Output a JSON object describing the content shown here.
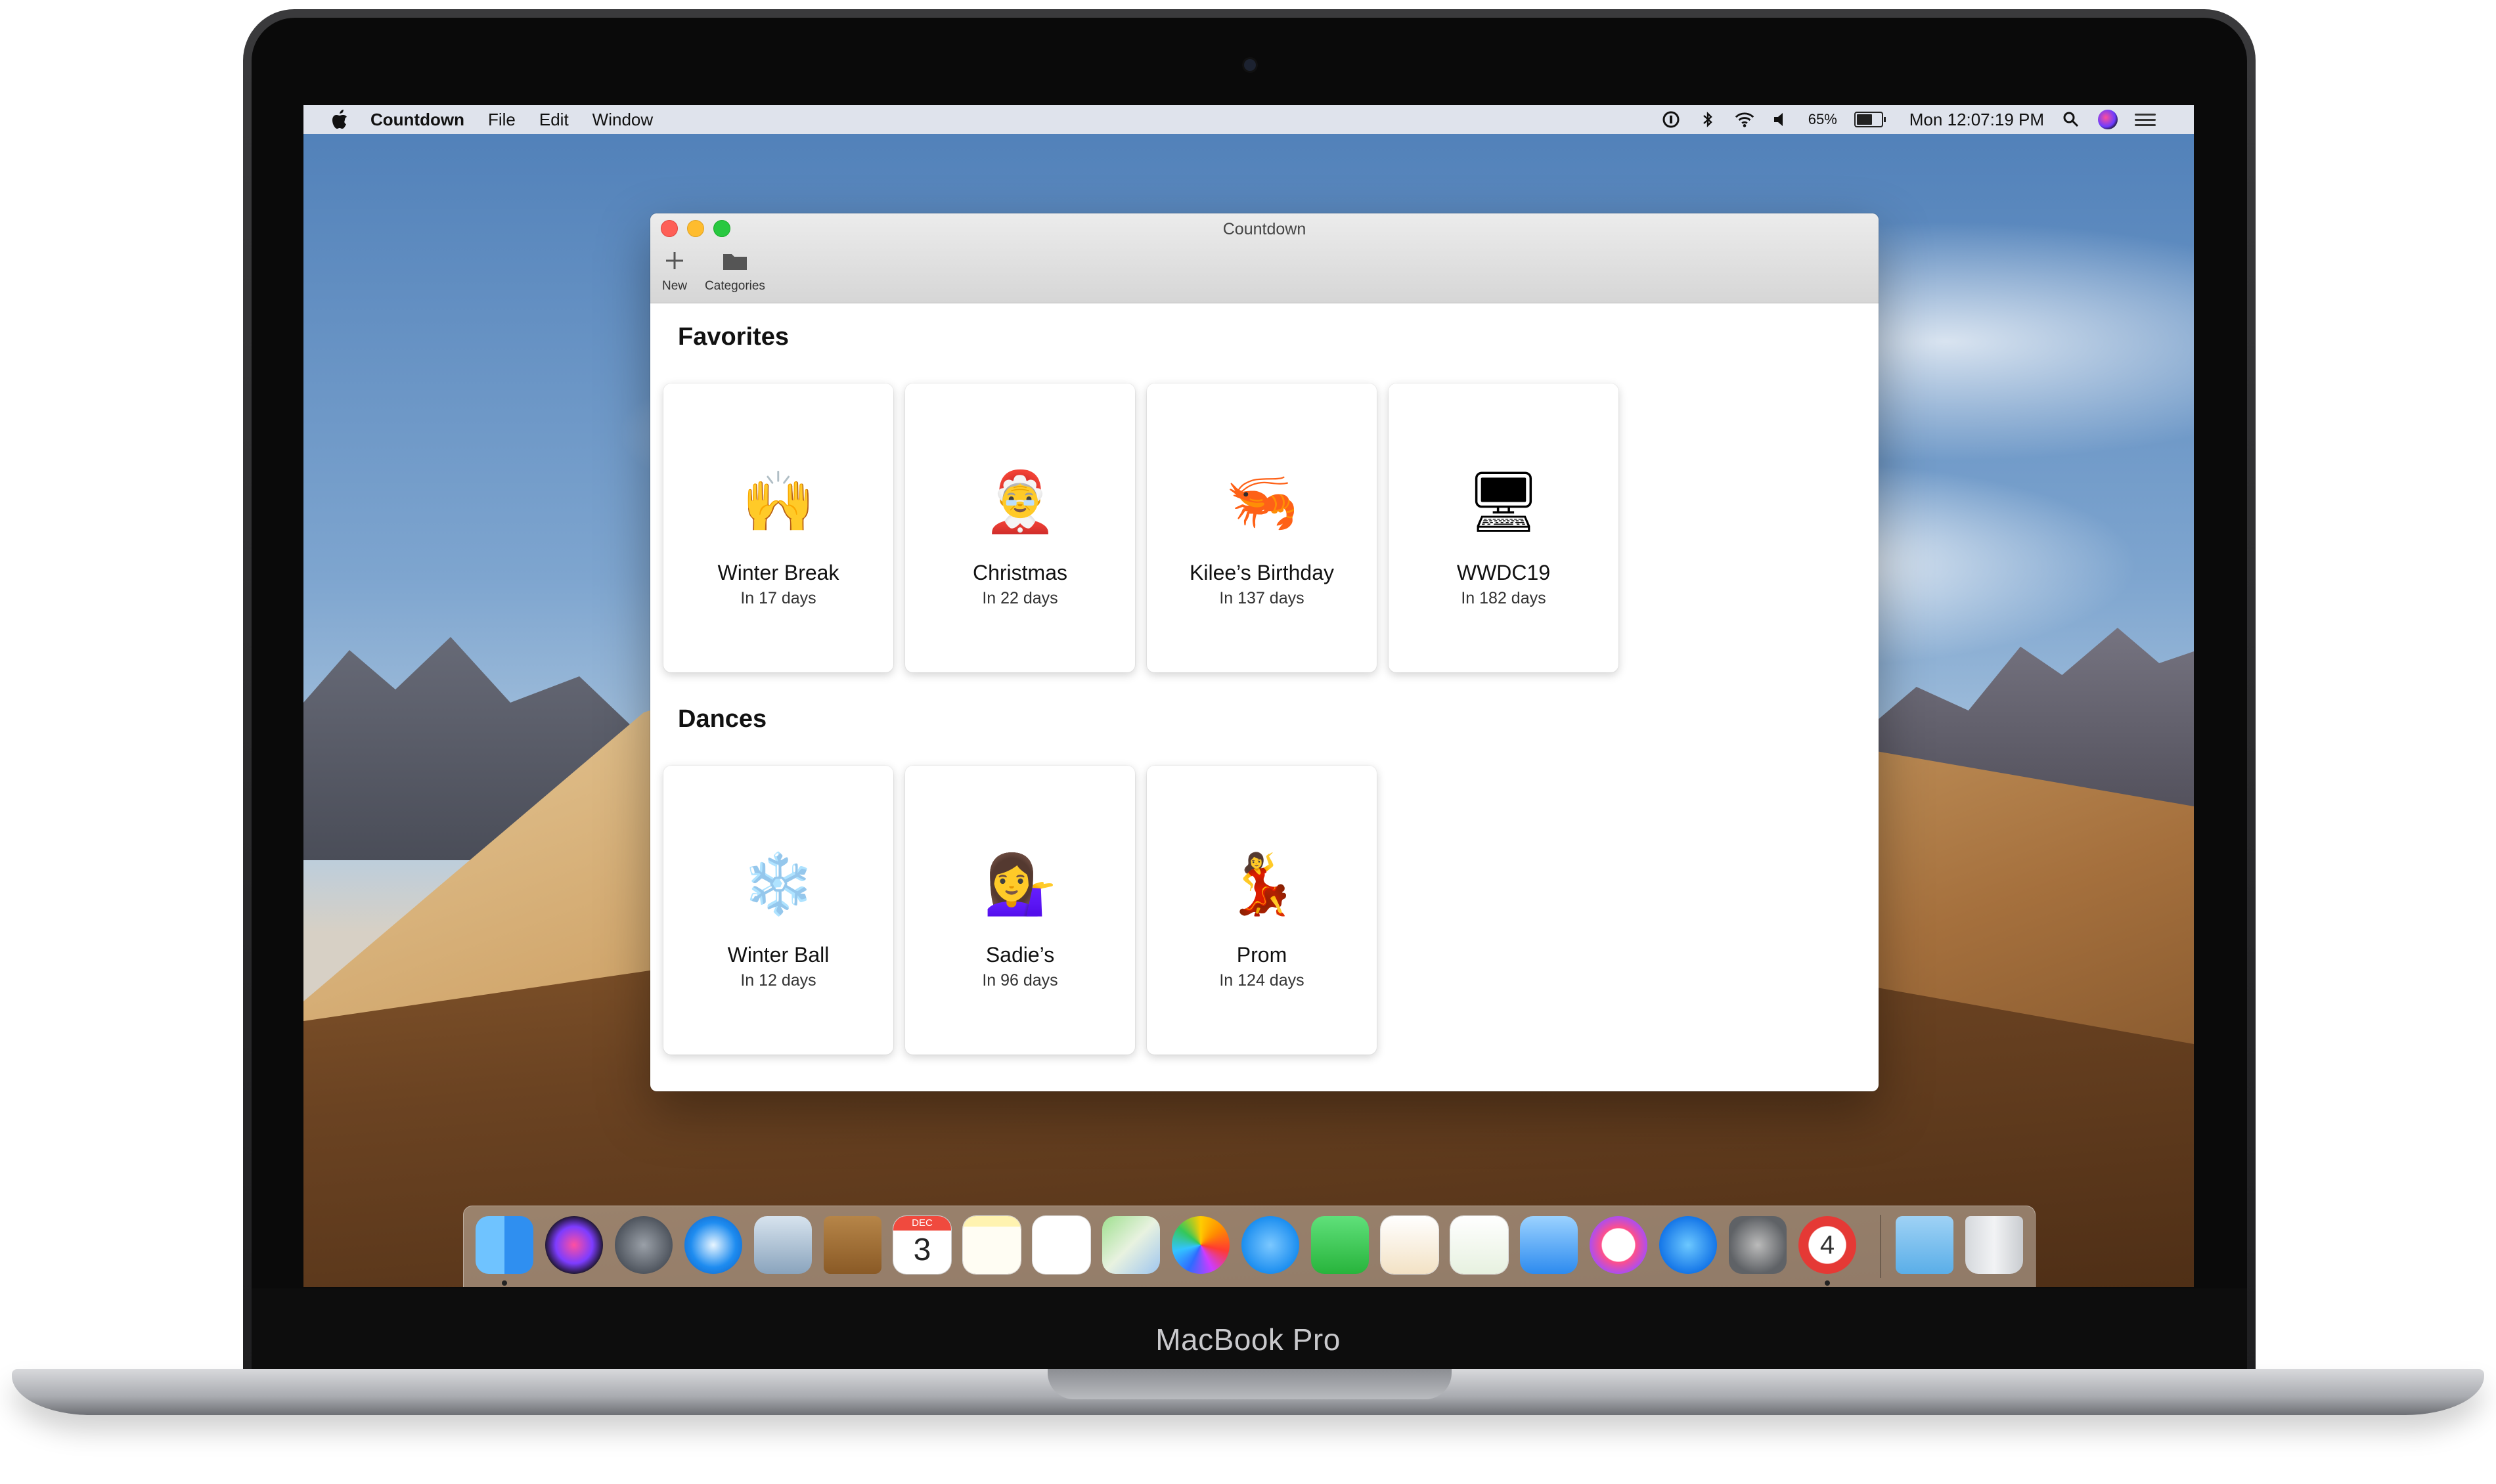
{
  "device": {
    "brand_label": "MacBook Pro"
  },
  "menubar": {
    "app_name": "Countdown",
    "menus": [
      "File",
      "Edit",
      "Window"
    ],
    "battery_percent": "65%",
    "clock": "Mon 12:07:19 PM",
    "battery_level": 0.65
  },
  "window": {
    "title": "Countdown",
    "toolbar": {
      "new_label": "New",
      "categories_label": "Categories"
    }
  },
  "sections": [
    {
      "title": "Favorites",
      "cards": [
        {
          "emoji": "🙌",
          "title": "Winter Break",
          "subtitle": "In 17 days"
        },
        {
          "emoji": "🤶",
          "title": "Christmas",
          "subtitle": "In 22 days"
        },
        {
          "emoji": "🦐",
          "title": "Kilee’s Birthday",
          "subtitle": "In 137 days"
        },
        {
          "emoji": "🖥",
          "title": "WWDC19",
          "subtitle": "In 182 days"
        }
      ]
    },
    {
      "title": "Dances",
      "cards": [
        {
          "emoji": "❄️",
          "title": "Winter Ball",
          "subtitle": "In 12 days"
        },
        {
          "emoji": "💁‍♀️",
          "title": "Sadie’s",
          "subtitle": "In 96 days"
        },
        {
          "emoji": "💃",
          "title": "Prom",
          "subtitle": "In 124 days"
        }
      ]
    }
  ],
  "dock": {
    "calendar_month": "DEC",
    "calendar_day": "3",
    "countdown_badge": "4",
    "apps": [
      "finder-icon",
      "siri-icon",
      "launchpad-icon",
      "safari-icon",
      "mail-icon",
      "contacts-icon",
      "calendar-icon",
      "notes-icon",
      "reminders-icon",
      "maps-icon",
      "photos-icon",
      "messages-icon",
      "facetime-icon",
      "pages-icon",
      "numbers-icon",
      "keynote-icon",
      "itunes-icon",
      "app-store-icon",
      "system-preferences-icon",
      "countdown-app-icon",
      "downloads-folder-icon",
      "trash-icon"
    ]
  }
}
